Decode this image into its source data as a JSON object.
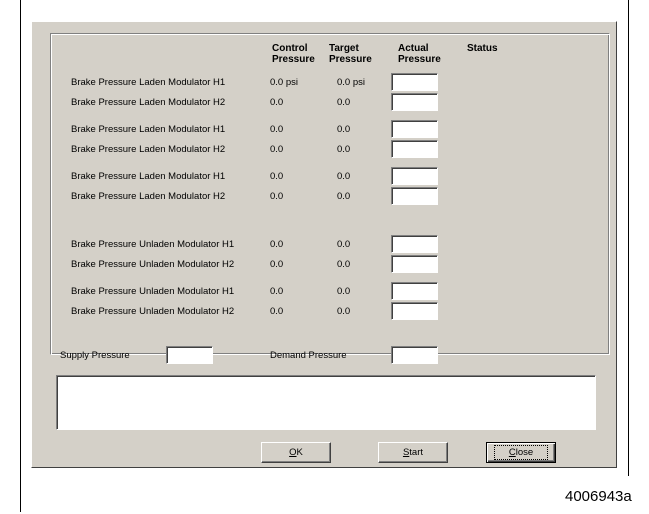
{
  "headers": {
    "control": "Control\nPressure",
    "target": "Target\nPressure",
    "actual": "Actual\nPressure",
    "status": "Status"
  },
  "rows": [
    {
      "label": "Brake Pressure  Laden  Modulator H1",
      "control": "0.0 psi",
      "target": "0.0 psi",
      "actual": ""
    },
    {
      "label": "Brake Pressure  Laden  Modulator H2",
      "control": "0.0",
      "target": "0.0",
      "actual": ""
    },
    {
      "label": "Brake Pressure  Laden  Modulator H1",
      "control": "0.0",
      "target": "0.0",
      "actual": ""
    },
    {
      "label": "Brake Pressure  Laden  Modulator H2",
      "control": "0.0",
      "target": "0.0",
      "actual": ""
    },
    {
      "label": "Brake Pressure  Laden  Modulator H1",
      "control": "0.0",
      "target": "0.0",
      "actual": ""
    },
    {
      "label": "Brake Pressure  Laden  Modulator H2",
      "control": "0.0",
      "target": "0.0",
      "actual": ""
    },
    {
      "label": "Brake Pressure  Unladen  Modulator H1",
      "control": "0.0",
      "target": "0.0",
      "actual": ""
    },
    {
      "label": "Brake Pressure  Unladen  Modulator H2",
      "control": "0.0",
      "target": "0.0",
      "actual": ""
    },
    {
      "label": "Brake Pressure  Unladen  Modulator H1",
      "control": "0.0",
      "target": "0.0",
      "actual": ""
    },
    {
      "label": "Brake Pressure  Unladen  Modulator H2",
      "control": "0.0",
      "target": "0.0",
      "actual": ""
    }
  ],
  "supply": {
    "label": "Supply Pressure",
    "value": ""
  },
  "demand": {
    "label": "Demand Pressure",
    "value": ""
  },
  "messages": "",
  "buttons": {
    "ok_mnemonic": "O",
    "ok_rest": "K",
    "start_mnemonic": "S",
    "start_rest": "tart",
    "close_mnemonic": "C",
    "close_rest": "lose"
  },
  "caption": "4006943a"
}
